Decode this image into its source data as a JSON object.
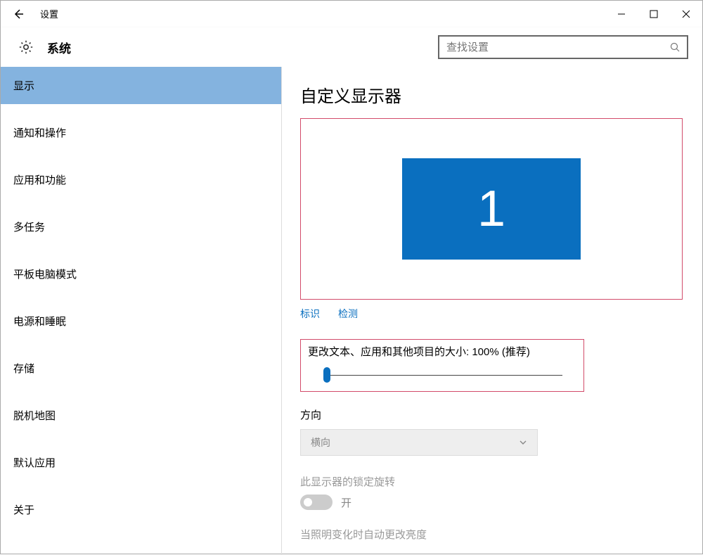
{
  "window": {
    "title": "设置"
  },
  "header": {
    "title": "系统"
  },
  "search": {
    "placeholder": "查找设置"
  },
  "sidebar": {
    "items": [
      {
        "label": "显示",
        "selected": true
      },
      {
        "label": "通知和操作"
      },
      {
        "label": "应用和功能"
      },
      {
        "label": "多任务"
      },
      {
        "label": "平板电脑模式"
      },
      {
        "label": "电源和睡眠"
      },
      {
        "label": "存储"
      },
      {
        "label": "脱机地图"
      },
      {
        "label": "默认应用"
      },
      {
        "label": "关于"
      }
    ]
  },
  "main": {
    "heading": "自定义显示器",
    "monitor_number": "1",
    "links": {
      "identify": "标识",
      "detect": "检测"
    },
    "scale_label": "更改文本、应用和其他项目的大小: 100% (推荐)",
    "orientation": {
      "label": "方向",
      "value": "横向"
    },
    "lock_rotation": {
      "label": "此显示器的锁定旋转",
      "state": "开"
    },
    "brightness_label": "当照明变化时自动更改亮度"
  }
}
